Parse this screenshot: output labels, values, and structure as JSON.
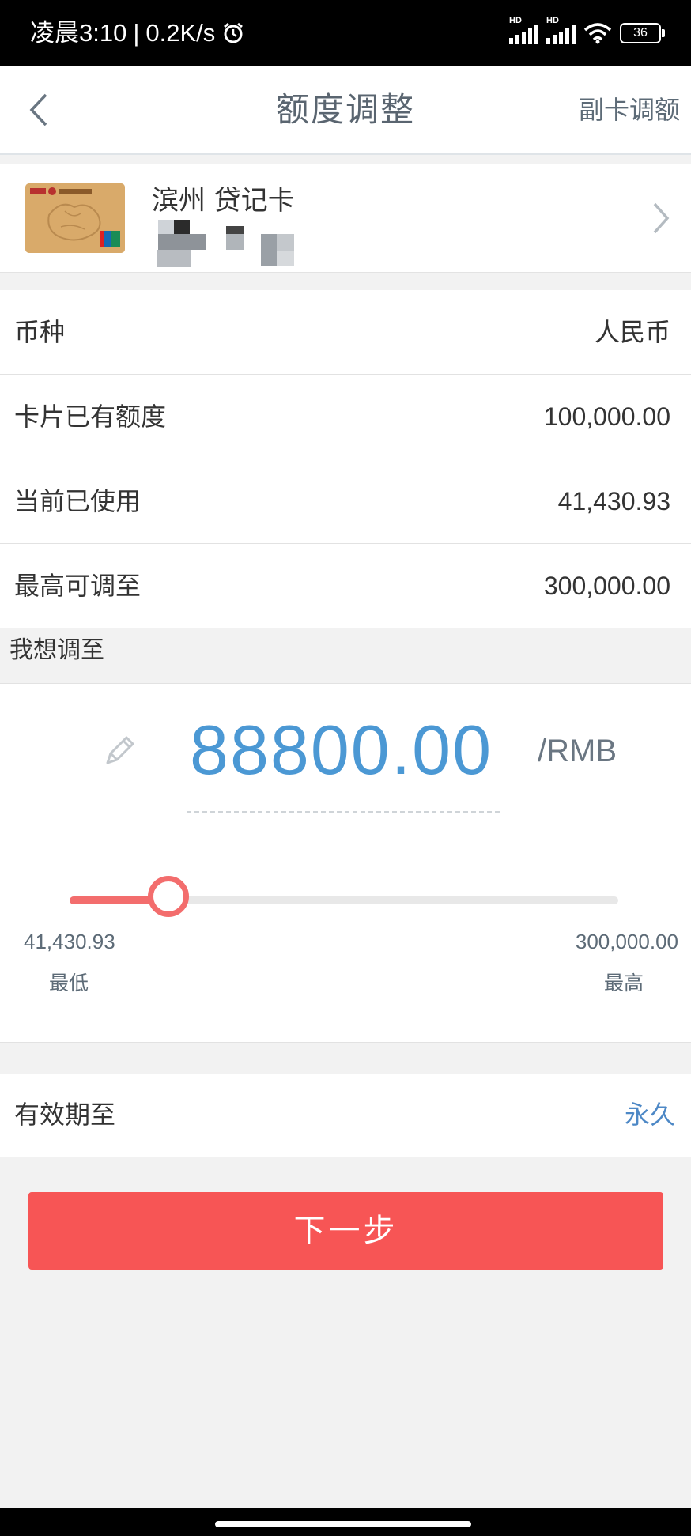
{
  "status_bar": {
    "time": "凌晨3:10",
    "separator": "|",
    "speed": "0.2K/s",
    "signal_label": "HD",
    "battery": "36"
  },
  "nav": {
    "title": "额度调整",
    "action": "副卡调额"
  },
  "card": {
    "name": "滨州 贷记卡"
  },
  "info_rows": [
    {
      "label": "币种",
      "value": "人民币"
    },
    {
      "label": "卡片已有额度",
      "value": "100,000.00"
    },
    {
      "label": "当前已使用",
      "value": "41,430.93"
    },
    {
      "label": "最高可调至",
      "value": "300,000.00"
    }
  ],
  "adjust": {
    "section_title": "我想调至",
    "amount": "88800.00",
    "unit": "/RMB",
    "min_value": "41,430.93",
    "max_value": "300,000.00",
    "min_label": "最低",
    "max_label": "最高",
    "slider_fraction": 0.18
  },
  "validity": {
    "label": "有效期至",
    "value": "永久"
  },
  "next_button": "下一步",
  "colors": {
    "accent_red": "#f75555",
    "amount_blue": "#4b98d4",
    "link_blue": "#4d88c6"
  }
}
